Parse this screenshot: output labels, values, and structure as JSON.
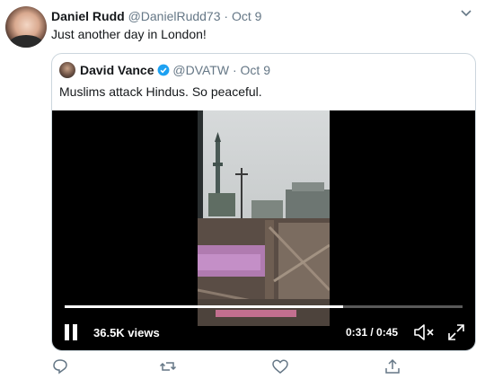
{
  "tweet": {
    "author_name": "Daniel Rudd",
    "author_handle": "@DanielRudd73",
    "separator": "·",
    "date": "Oct 9",
    "text": "Just another day in London!"
  },
  "quoted_tweet": {
    "author_name": "David Vance",
    "author_handle": "@DVATW",
    "separator": "·",
    "date": "Oct 9",
    "text": "Muslims attack Hindus. So peaceful.",
    "verified": true
  },
  "video": {
    "views": "36.5K views",
    "time": "0:31 / 0:45",
    "progress": 0.7
  },
  "icons": {
    "caret": "chevron-down-icon",
    "verified": "verified-badge-icon",
    "pause": "pause-icon",
    "mute": "volume-muted-icon",
    "fullscreen": "fullscreen-icon",
    "reply": "reply-icon",
    "retweet": "retweet-icon",
    "like": "like-icon",
    "share": "share-icon"
  },
  "colors": {
    "accent": "#1da1f2",
    "muted_text": "#657786",
    "border": "#ccd6dd"
  }
}
